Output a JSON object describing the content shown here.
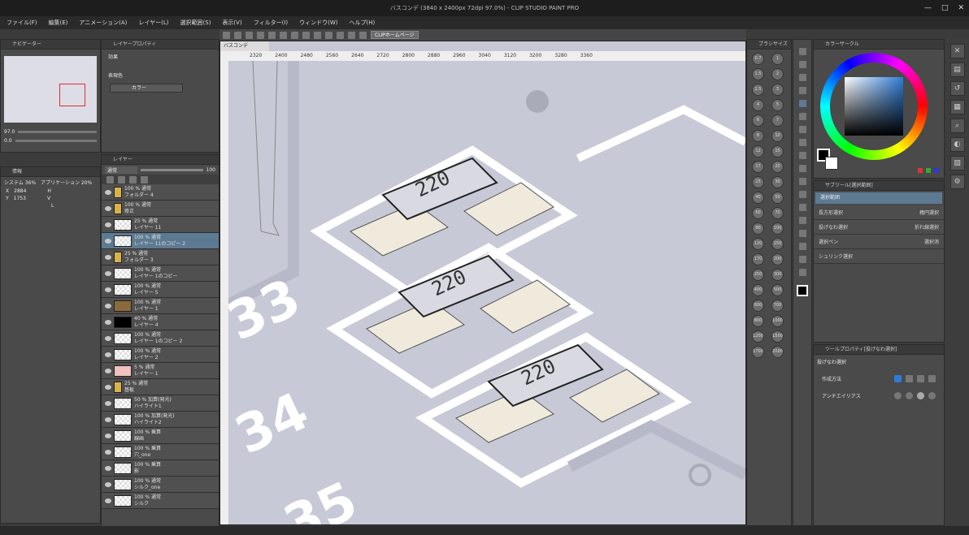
{
  "title_bar": {
    "text": "バスコンデ (3840 x 2400px 72dpi 97.0%) - CLIP STUDIO PAINT PRO",
    "minimize": "—",
    "maximize": "□",
    "close": "✕"
  },
  "menu": [
    "ファイル(F)",
    "編集(E)",
    "アニメーション(A)",
    "レイヤー(L)",
    "選択範囲(S)",
    "表示(V)",
    "フィルター(I)",
    "ウィンドウ(W)",
    "ヘルプ(H)"
  ],
  "toolbar": {
    "clip_home": "CLIPホームページ"
  },
  "navigator": {
    "title": "ナビゲーター",
    "zoom": "97.0",
    "rotation": "0.0"
  },
  "layer_property": {
    "title": "レイヤープロパティ",
    "effect_label": "効果",
    "color_label": "表現色",
    "color_value": "カラー"
  },
  "info_panel": {
    "title": "情報",
    "system_label": "システム 36%",
    "app_label": "アプリケーション 20%",
    "x_label": "X",
    "x_value": "2884",
    "y_label": "Y",
    "y_value": "1753",
    "h_label": "H",
    "v_label": "V",
    "l_label": "L"
  },
  "layer_panel": {
    "title": "レイヤー",
    "blend_mode": "通常",
    "opacity": "100",
    "layers": [
      {
        "line1": "100 % 通常",
        "line2": "フォルダー 4",
        "thumb": "folder",
        "selected": false
      },
      {
        "line1": "100 % 通常",
        "line2": "修正",
        "thumb": "folder",
        "selected": false
      },
      {
        "line1": "25 % 通常",
        "line2": "レイヤー 11",
        "thumb": "check",
        "selected": false
      },
      {
        "line1": "100 % 通常",
        "line2": "レイヤー 11のコピー 2",
        "thumb": "check",
        "selected": true
      },
      {
        "line1": "25 % 通常",
        "line2": "フォルダー 3",
        "thumb": "folder",
        "selected": false
      },
      {
        "line1": "100 % 通常",
        "line2": "レイヤー 1のコピー",
        "thumb": "check",
        "selected": false
      },
      {
        "line1": "100 % 通常",
        "line2": "レイヤー 5",
        "thumb": "check",
        "selected": false
      },
      {
        "line1": "100 % 通常",
        "line2": "レイヤー 1",
        "thumb": "brown",
        "selected": false
      },
      {
        "line1": "40 % 通常",
        "line2": "レイヤー 4",
        "thumb": "black",
        "selected": false
      },
      {
        "line1": "100 % 通常",
        "line2": "レイヤー 1のコピー 2",
        "thumb": "check",
        "selected": false
      },
      {
        "line1": "100 % 通常",
        "line2": "レイヤー 2",
        "thumb": "check",
        "selected": false
      },
      {
        "line1": "5 % 通常",
        "line2": "レイヤー 1",
        "thumb": "pink",
        "selected": false
      },
      {
        "line1": "25 % 通常",
        "line2": "基板",
        "thumb": "folder",
        "selected": false
      },
      {
        "line1": "50 % 加算(発光)",
        "line2": "ハイライト1",
        "thumb": "check",
        "selected": false
      },
      {
        "line1": "100 % 加算(発光)",
        "line2": "ハイライト2",
        "thumb": "check",
        "selected": false
      },
      {
        "line1": "100 % 乗算",
        "line2": "線画",
        "thumb": "check",
        "selected": false
      },
      {
        "line1": "100 % 乗算",
        "line2": "穴_one",
        "thumb": "check",
        "selected": false
      },
      {
        "line1": "100 % 乗算",
        "line2": "影",
        "thumb": "check",
        "selected": false
      },
      {
        "line1": "100 % 通常",
        "line2": "シルク_one",
        "thumb": "check",
        "selected": false
      },
      {
        "line1": "100 % 通常",
        "line2": "シルク",
        "thumb": "check",
        "selected": false
      }
    ]
  },
  "canvas": {
    "tab": "バスコンデ",
    "ruler_ticks": [
      "2320",
      "2400",
      "2480",
      "2560",
      "2640",
      "2720",
      "2800",
      "2880",
      "2960",
      "3040",
      "3120",
      "3200",
      "3280",
      "3360"
    ],
    "chip_label": "220",
    "pcb_numbers": [
      "33",
      "34",
      "35"
    ],
    "colors": {
      "board": "#c7c9d7",
      "silk": "#ffffff",
      "pad": "#efeadb"
    }
  },
  "brush_size": {
    "title": "ブラシサイズ",
    "sizes": [
      "0.7",
      "1",
      "1.5",
      "2",
      "2.5",
      "3",
      "4",
      "5",
      "6",
      "7",
      "8",
      "10",
      "12",
      "15",
      "17",
      "20",
      "25",
      "30",
      "40",
      "50",
      "60",
      "70",
      "80",
      "100",
      "120",
      "150",
      "170",
      "200",
      "250",
      "300",
      "400",
      "500",
      "600",
      "700",
      "800",
      "1000",
      "1200",
      "1500",
      "1700",
      "2000"
    ]
  },
  "color_circle": {
    "title": "カラーサークル",
    "accent": "#2e7cd6",
    "hue_value": "195"
  },
  "sub_tool": {
    "title": "サブツール[選択範囲]",
    "group": "選択範囲",
    "items": [
      {
        "left": "長方形選択",
        "right": "楕円選択"
      },
      {
        "left": "投げなわ選択",
        "right": "折れ線選択"
      },
      {
        "left": "選択ペン",
        "right": "選択消"
      },
      {
        "left": "シュリンク選択",
        "right": ""
      }
    ]
  },
  "tool_property": {
    "title": "ツールプロパティ[投げなわ選択]",
    "tool_name": "投げなわ選択",
    "creation_label": "作成方法",
    "antialias_label": "アンチエイリアス"
  }
}
